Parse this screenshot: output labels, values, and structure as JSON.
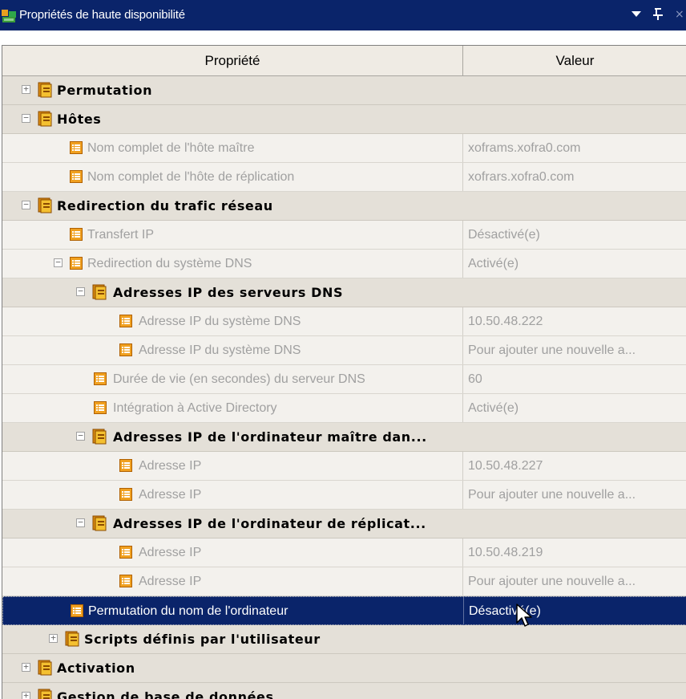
{
  "window": {
    "title": "Propriétés de haute disponibilité",
    "icons": [
      "app-icon",
      "dropdown-arrow-icon",
      "pin-icon",
      "close-icon"
    ],
    "close_glyph": "×",
    "pin_glyph": "ᵖ"
  },
  "grid": {
    "headers": {
      "property": "Propriété",
      "value": "Valeur"
    },
    "rows": [
      {
        "type": "cat",
        "expander": "+",
        "label": "Permutation",
        "value": ""
      },
      {
        "type": "cat",
        "expander": "−",
        "label": "Hôtes",
        "value": ""
      },
      {
        "type": "item",
        "expander": "",
        "label": "Nom complet de l'hôte maître",
        "value": "xoframs.xofra0.com"
      },
      {
        "type": "item",
        "expander": "",
        "label": "Nom complet de l'hôte de réplication",
        "value": "xofrars.xofra0.com"
      },
      {
        "type": "cat",
        "expander": "−",
        "label": "Redirection du trafic réseau",
        "value": ""
      },
      {
        "type": "item",
        "expander": "",
        "label": "Transfert IP",
        "value": "Désactivé(e)"
      },
      {
        "type": "item",
        "expander": "−",
        "label": "Redirection du système DNS",
        "value": "Activé(e)"
      },
      {
        "type": "cat",
        "expander": "−",
        "label": "Adresses IP des serveurs DNS",
        "value": ""
      },
      {
        "type": "item",
        "expander": "",
        "label": "Adresse IP du système DNS",
        "value": "10.50.48.222"
      },
      {
        "type": "item",
        "expander": "",
        "label": "Adresse IP du système DNS",
        "value": "Pour ajouter une nouvelle a..."
      },
      {
        "type": "item",
        "expander": "",
        "label": "Durée de vie (en secondes) du serveur DNS",
        "value": "60"
      },
      {
        "type": "item",
        "expander": "",
        "label": "Intégration à Active Directory",
        "value": "Activé(e)"
      },
      {
        "type": "cat",
        "expander": "−",
        "label": "Adresses IP de l'ordinateur maître dan...",
        "value": ""
      },
      {
        "type": "item",
        "expander": "",
        "label": "Adresse IP",
        "value": "10.50.48.227"
      },
      {
        "type": "item",
        "expander": "",
        "label": "Adresse IP",
        "value": "Pour ajouter une nouvelle a..."
      },
      {
        "type": "cat",
        "expander": "−",
        "label": "Adresses IP de l'ordinateur de réplicat...",
        "value": ""
      },
      {
        "type": "item",
        "expander": "",
        "label": "Adresse IP",
        "value": "10.50.48.219"
      },
      {
        "type": "item",
        "expander": "",
        "label": "Adresse IP",
        "value": "Pour ajouter une nouvelle a..."
      },
      {
        "type": "selected",
        "expander": "",
        "label": "Permutation du nom de l'ordinateur",
        "value": "Désactivé(e)"
      },
      {
        "type": "cat",
        "expander": "+",
        "label": "Scripts définis par l'utilisateur",
        "value": ""
      },
      {
        "type": "cat",
        "expander": "+",
        "label": "Activation",
        "value": ""
      },
      {
        "type": "cat",
        "expander": "+",
        "label": "Gestion de base de données",
        "value": ""
      }
    ]
  },
  "colors": {
    "title_bar": "#0a246a",
    "category_row": "#e4e0d8",
    "item_row": "#f3f1ed",
    "selected_row": "#0a246a",
    "disabled_text": "#a0a0a0"
  }
}
